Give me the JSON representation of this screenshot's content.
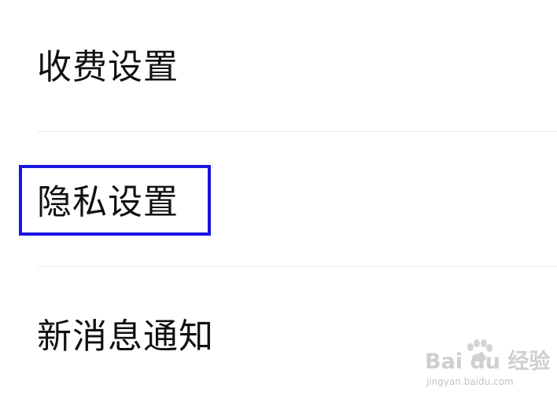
{
  "settings": {
    "items": [
      {
        "label": "收费设置",
        "highlighted": false
      },
      {
        "label": "隐私设置",
        "highlighted": true
      },
      {
        "label": "新消息通知",
        "highlighted": false
      }
    ],
    "highlight_color": "#1a14e0"
  },
  "watermark": {
    "brand": "Bai du 经验",
    "url": "jingyan.baidu.com",
    "icon": "paw-icon"
  }
}
